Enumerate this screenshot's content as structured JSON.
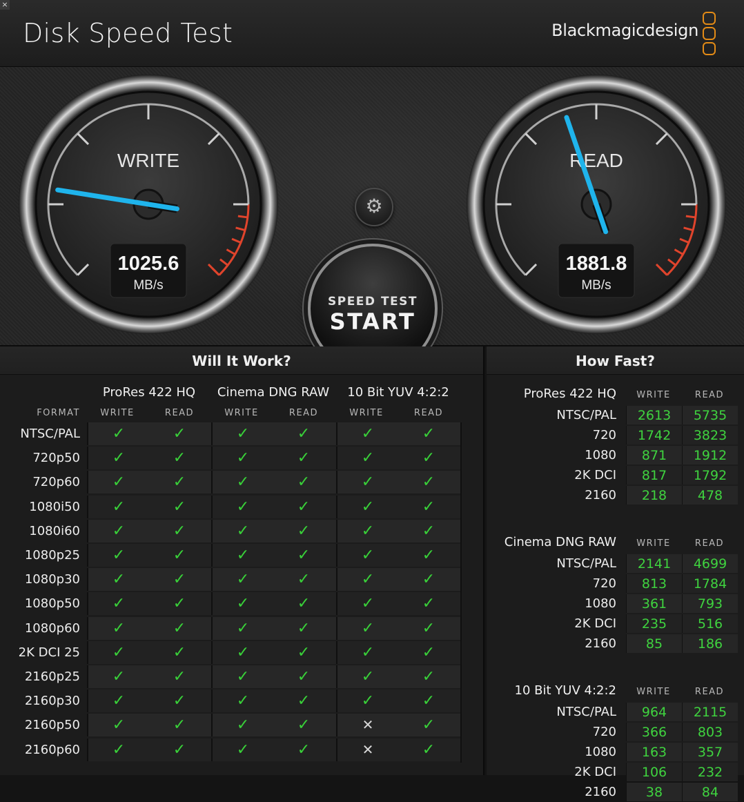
{
  "app": {
    "title": "Disk Speed Test",
    "brand": "Blackmagicdesign",
    "close_glyph": "×"
  },
  "gauges": {
    "write": {
      "label": "WRITE",
      "value": "1025.6",
      "unit": "MB/s",
      "needle_level": 0.2
    },
    "read": {
      "label": "READ",
      "value": "1881.8",
      "unit": "MB/s",
      "needle_level": 0.43
    }
  },
  "controls": {
    "settings_icon": "gear-icon",
    "start_line1": "SPEED TEST",
    "start_line2": "START"
  },
  "colors": {
    "needle": "#1fb4ec",
    "redzone": "#e0442c",
    "check": "#39d139",
    "value_green": "#3fd33f",
    "brand_orange": "#e38b16"
  },
  "will_it_work": {
    "title": "Will It Work?",
    "format_header": "FORMAT",
    "groups": [
      {
        "name": "ProRes 422 HQ",
        "write": "WRITE",
        "read": "READ"
      },
      {
        "name": "Cinema DNG RAW",
        "write": "WRITE",
        "read": "READ"
      },
      {
        "name": "10 Bit YUV 4:2:2",
        "write": "WRITE",
        "read": "READ"
      }
    ],
    "check_glyph": "✓",
    "cross_glyph": "✕",
    "rows": [
      {
        "format": "NTSC/PAL",
        "cells": [
          true,
          true,
          true,
          true,
          true,
          true
        ]
      },
      {
        "format": "720p50",
        "cells": [
          true,
          true,
          true,
          true,
          true,
          true
        ]
      },
      {
        "format": "720p60",
        "cells": [
          true,
          true,
          true,
          true,
          true,
          true
        ]
      },
      {
        "format": "1080i50",
        "cells": [
          true,
          true,
          true,
          true,
          true,
          true
        ]
      },
      {
        "format": "1080i60",
        "cells": [
          true,
          true,
          true,
          true,
          true,
          true
        ]
      },
      {
        "format": "1080p25",
        "cells": [
          true,
          true,
          true,
          true,
          true,
          true
        ]
      },
      {
        "format": "1080p30",
        "cells": [
          true,
          true,
          true,
          true,
          true,
          true
        ]
      },
      {
        "format": "1080p50",
        "cells": [
          true,
          true,
          true,
          true,
          true,
          true
        ]
      },
      {
        "format": "1080p60",
        "cells": [
          true,
          true,
          true,
          true,
          true,
          true
        ]
      },
      {
        "format": "2K DCI 25",
        "cells": [
          true,
          true,
          true,
          true,
          true,
          true
        ]
      },
      {
        "format": "2160p25",
        "cells": [
          true,
          true,
          true,
          true,
          true,
          true
        ]
      },
      {
        "format": "2160p30",
        "cells": [
          true,
          true,
          true,
          true,
          true,
          true
        ]
      },
      {
        "format": "2160p50",
        "cells": [
          true,
          true,
          true,
          true,
          false,
          true
        ]
      },
      {
        "format": "2160p60",
        "cells": [
          true,
          true,
          true,
          true,
          false,
          true
        ]
      }
    ]
  },
  "how_fast": {
    "title": "How Fast?",
    "write_header": "WRITE",
    "read_header": "READ",
    "groups": [
      {
        "name": "ProRes 422 HQ",
        "rows": [
          {
            "label": "NTSC/PAL",
            "write": "2613",
            "read": "5735"
          },
          {
            "label": "720",
            "write": "1742",
            "read": "3823"
          },
          {
            "label": "1080",
            "write": "871",
            "read": "1912"
          },
          {
            "label": "2K DCI",
            "write": "817",
            "read": "1792"
          },
          {
            "label": "2160",
            "write": "218",
            "read": "478"
          }
        ]
      },
      {
        "name": "Cinema DNG RAW",
        "rows": [
          {
            "label": "NTSC/PAL",
            "write": "2141",
            "read": "4699"
          },
          {
            "label": "720",
            "write": "813",
            "read": "1784"
          },
          {
            "label": "1080",
            "write": "361",
            "read": "793"
          },
          {
            "label": "2K DCI",
            "write": "235",
            "read": "516"
          },
          {
            "label": "2160",
            "write": "85",
            "read": "186"
          }
        ]
      },
      {
        "name": "10 Bit YUV 4:2:2",
        "rows": [
          {
            "label": "NTSC/PAL",
            "write": "964",
            "read": "2115"
          },
          {
            "label": "720",
            "write": "366",
            "read": "803"
          },
          {
            "label": "1080",
            "write": "163",
            "read": "357"
          },
          {
            "label": "2K DCI",
            "write": "106",
            "read": "232"
          },
          {
            "label": "2160",
            "write": "38",
            "read": "84"
          }
        ]
      }
    ]
  }
}
